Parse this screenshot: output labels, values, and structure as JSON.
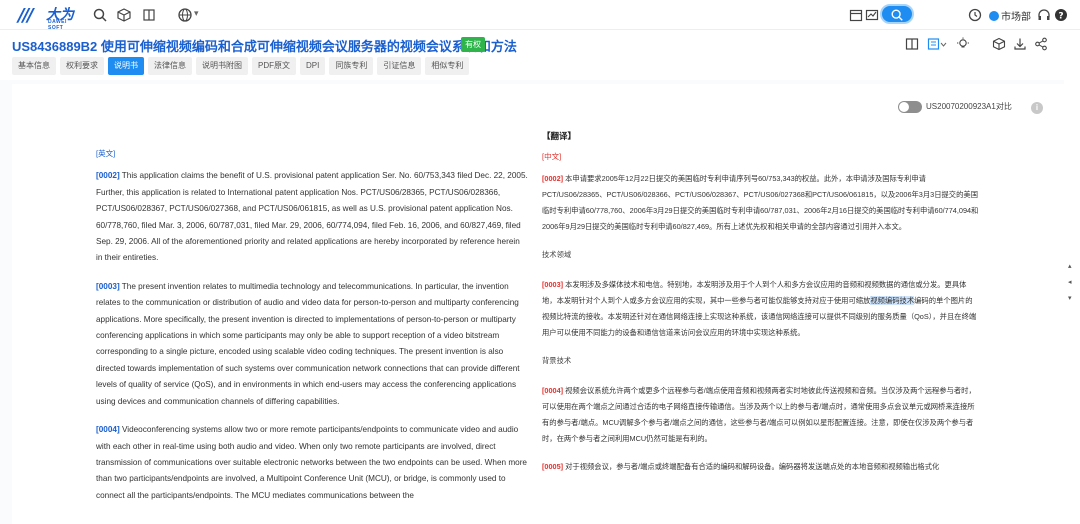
{
  "app": {
    "logo_text": "大为",
    "logo_sub": "DAWEI SOFT",
    "user_label": "市场部"
  },
  "icons": {
    "nav": [
      "search-icon",
      "cube-icon",
      "book-icon",
      "globe-icon"
    ],
    "right": [
      "calendar-icon",
      "chart-icon",
      "search-icon",
      "clock-icon",
      "user-icon",
      "headset-icon",
      "help-icon"
    ],
    "title_tools": [
      "split-view-icon",
      "layout-dropdown-icon",
      "lightbulb-icon",
      "cube-icon",
      "download-icon",
      "share-icon"
    ]
  },
  "colors": {
    "accent": "#1e8cf0",
    "title": "#1a5fd0",
    "status": "#2fb34b",
    "zh_marker": "#e0332f"
  },
  "patent": {
    "number_title": "US8436889B2  使用可伸缩视频编码和合成可伸缩视频会议服务器的视频会议系统和方法",
    "status": "有权"
  },
  "tabs": [
    {
      "label": "基本信息",
      "active": false
    },
    {
      "label": "权利要求",
      "active": false
    },
    {
      "label": "说明书",
      "active": true
    },
    {
      "label": "法律信息",
      "active": false
    },
    {
      "label": "说明书附图",
      "active": false
    },
    {
      "label": "PDF原文",
      "active": false
    },
    {
      "label": "DPI",
      "active": false
    },
    {
      "label": "同族专利",
      "active": false
    },
    {
      "label": "引证信息",
      "active": false
    },
    {
      "label": "相似专利",
      "active": false
    }
  ],
  "compare": {
    "toggle_label": "US20070200923A1对比",
    "info": "i"
  },
  "english": {
    "lang": "[英文]",
    "paragraphs": [
      {
        "num": "[0002]",
        "text": " This application claims the benefit of U.S. provisional patent application Ser. No. 60/753,343 filed Dec. 22, 2005. Further, this application is related to International patent application Nos. PCT/US06/28365, PCT/US06/028366, PCT/US06/028367, PCT/US06/027368, and PCT/US06/061815, as well as U.S. provisional patent application Nos. 60/778,760, filed Mar. 3, 2006, 60/787,031, filed Mar. 29, 2006, 60/774,094, filed Feb. 16, 2006, and 60/827,469, filed Sep. 29, 2006. All of the aforementioned priority and related applications are hereby incorporated by reference herein in their entireties."
      },
      {
        "num": "[0003]",
        "text": " The present invention relates to multimedia technology and telecommunications. In particular, the invention relates to the communication or distribution of audio and video data for person-to-person and multiparty conferencing applications. More specifically, the present invention is directed to implementations of person-to-person or multiparty conferencing applications in which some participants may only be able to support reception of a video bitstream corresponding to a single picture, encoded using scalable video coding techniques. The present invention is also directed towards implementation of such systems over communication network connections that can provide different levels of quality of service (QoS), and in environments in which end-users may access the conferencing applications using devices and communication channels of differing capabilities."
      },
      {
        "num": "[0004]",
        "text": " Videoconferencing systems allow two or more remote participants/endpoints to communicate video and audio with each other in real-time using both audio and video. When only two remote participants are involved, direct transmission of communications over suitable electronic networks between the two endpoints can be used. When more than two participants/endpoints are involved, a Multipoint Conference Unit (MCU), or bridge, is commonly used to connect all the participants/endpoints. The MCU mediates communications between the"
      }
    ]
  },
  "chinese": {
    "section_title": "【翻译】",
    "lang": "[中文]",
    "p0002": {
      "num": "[0002]",
      "text": " 本申请要求2005年12月22日提交的美国临时专利申请序列号60/753,343的权益。此外，本申请涉及国际专利申请PCT/US06/28365、PCT/US06/028366、PCT/US06/028367、PCT/US06/027368和PCT/US06/061815，以及2006年3月3日提交的美国临时专利申请60/778,760、2006年3月29日提交的美国临时专利申请60/787,031、2006年2月16日提交的美国临时专利申请60/774,094和2006年9月29日提交的美国临时专利申请60/827,469。所有上述优先权和相关申请的全部内容通过引用并入本文。"
    },
    "field_heading": "技术领域",
    "p0003": {
      "num": "[0003]",
      "before": " 本发明涉及多媒体技术和电信。特别地，本发明涉及用于个人到个人和多方会议应用的音频和视频数据的通信或分发。更具体地，本发明针对个人到个人或多方会议应用的实现，其中一些参与者可能仅能够支持对应于使用可缩放",
      "highlight": "视频编码技术",
      "after": "编码的单个图片的视频比特流的接收。本发明还针对在通信网络连接上实现这种系统，该通信网络连接可以提供不同级别的服务质量（QoS），并且在终端用户可以使用不同能力的设备和通信信道来访问会议应用的环境中实现这种系统。"
    },
    "background_heading": "背景技术",
    "p0004": {
      "num": "[0004]",
      "text": " 视频会议系统允许两个或更多个远程参与者/端点使用音频和视频两者实时地彼此传送视频和音频。当仅涉及两个远程参与者时，可以使用在两个端点之间通过合适的电子网络直接传输通信。当涉及两个以上的参与者/端点时，通常使用多点会议单元或网桥来连接所有的参与者/端点。MCU调解多个参与者/端点之间的通信，这些参与者/端点可以例如以星形配置连接。注意，即使在仅涉及两个参与者时，在两个参与者之间利用MCU仍然可能是有利的。"
    },
    "p0005": {
      "num": "[0005]",
      "text": " 对于视频会议，参与者/端点或终端配备有合适的编码和解码设备。编码器将发送端点处的本地音频和视频输出格式化"
    }
  }
}
